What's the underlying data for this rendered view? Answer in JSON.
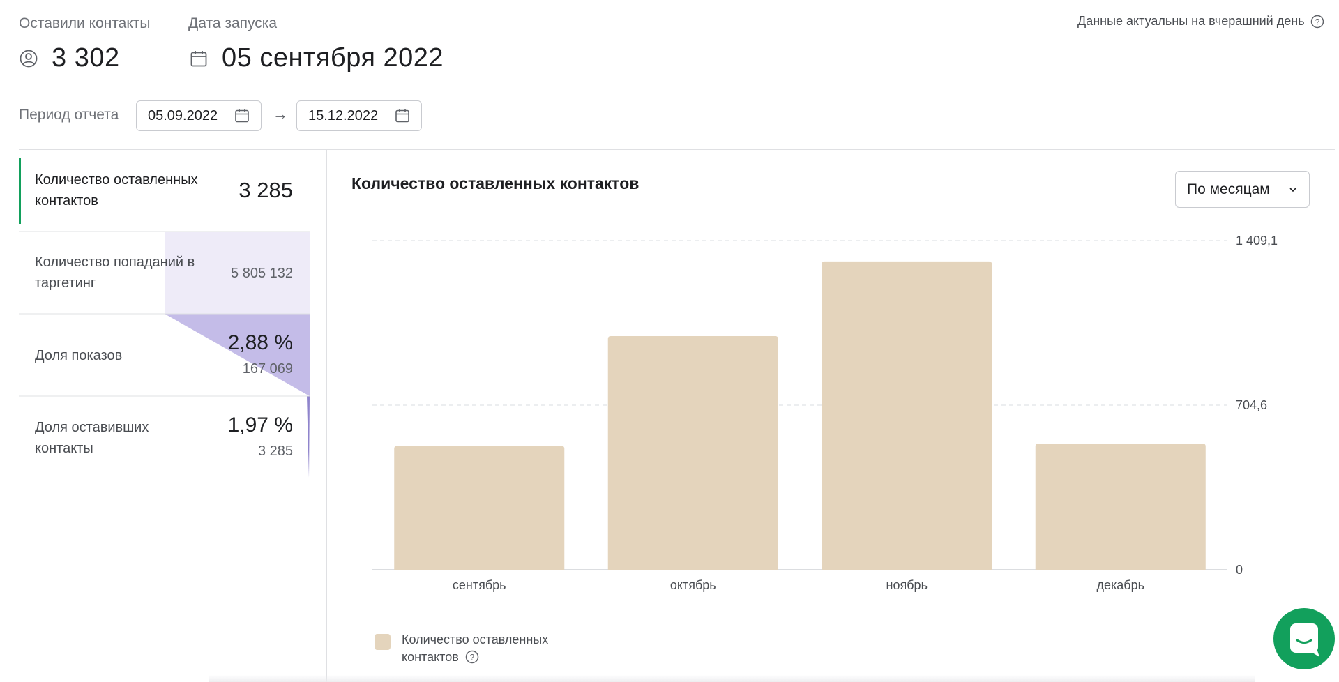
{
  "header": {
    "contacts": {
      "label": "Оставили контакты",
      "value": "3 302",
      "icon": "user-circle-icon"
    },
    "launch": {
      "label": "Дата запуска",
      "value": "05 сентября 2022",
      "icon": "calendar-icon"
    },
    "freshness_note": "Данные актуальны на вчерашний день"
  },
  "period": {
    "label": "Период отчета",
    "from": "05.09.2022",
    "to": "15.12.2022",
    "arrow": "→"
  },
  "funnel": [
    {
      "label": "Количество оставленных контактов",
      "value": "3 285",
      "active": true
    },
    {
      "label": "Количество попаданий в таргетинг",
      "value": "5 805 132"
    },
    {
      "label": "Доля показов",
      "percent": "2,88 %",
      "value": "167 069"
    },
    {
      "label": "Доля оставивших контакты",
      "percent": "1,97 %",
      "value": "3 285"
    }
  ],
  "chart_panel": {
    "title": "Количество оставленных контактов",
    "grouping": {
      "selected": "По месяцам"
    }
  },
  "chart_data": {
    "type": "bar",
    "categories": [
      "сентябрь",
      "октябрь",
      "ноябрь",
      "декабрь"
    ],
    "series": [
      {
        "name": "Количество оставленных контактов",
        "values": [
          530,
          1000,
          1320,
          540
        ]
      }
    ],
    "ylim": [
      0,
      1409.1
    ],
    "yticks": [
      {
        "value": 0,
        "label": "0"
      },
      {
        "value": 704.6,
        "label": "704,6"
      },
      {
        "value": 1409.1,
        "label": "1 409,1"
      }
    ],
    "grid": true,
    "legend": "bottom-left",
    "colors": {
      "bar": "#e4d4bc",
      "grid": "#d9dde0"
    }
  },
  "colors": {
    "accent_green": "#12a05c",
    "funnel_light": "#eeebf8",
    "funnel_mid": "#c4bce8",
    "funnel_dark": "#8f84cc"
  }
}
